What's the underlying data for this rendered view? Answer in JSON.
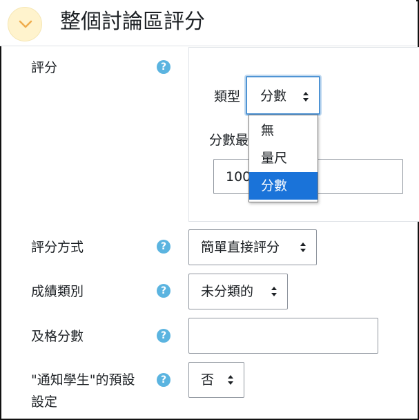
{
  "section": {
    "title": "整個討論區評分"
  },
  "grade": {
    "label": "評分",
    "help": "?",
    "type_label": "類型",
    "type_selected": "分數",
    "maxgrade_label": "分數最",
    "maxgrade_value": "100",
    "type_options": [
      "無",
      "量尺",
      "分數"
    ]
  },
  "grading_method": {
    "label": "評分方式",
    "help": "?",
    "value": "簡單直接評分"
  },
  "grade_category": {
    "label": "成績類別",
    "help": "?",
    "value": "未分類的"
  },
  "pass_grade": {
    "label": "及格分數",
    "help": "?",
    "value": ""
  },
  "notify_students": {
    "label_line1": "\"通知學生\"的預設",
    "label_line2": "設定",
    "help": "?",
    "value": "否"
  },
  "colors": {
    "accent": "#1a73d9",
    "help_icon": "#5bb4e0",
    "toggle_bg": "#fff3cd",
    "chevron": "#f0ad4e"
  }
}
